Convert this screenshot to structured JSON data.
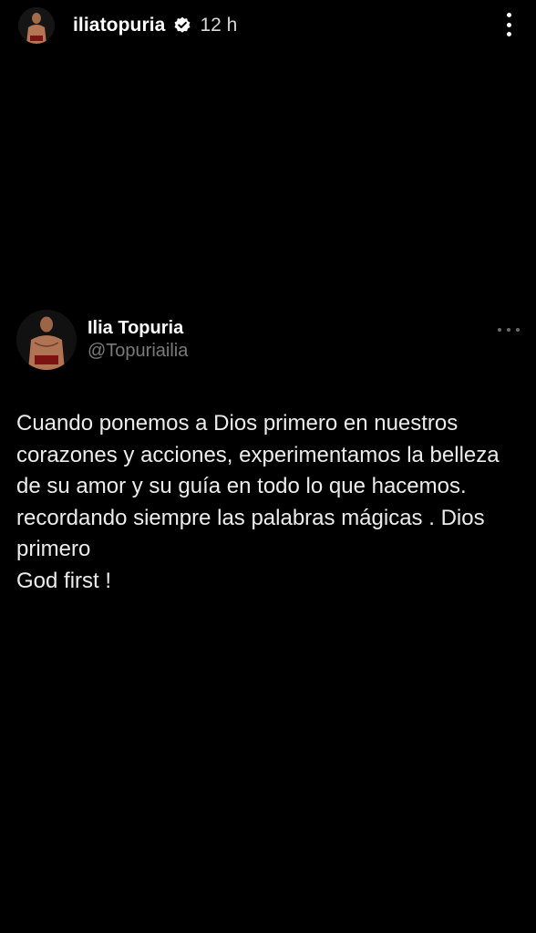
{
  "story": {
    "username": "iliatopuria",
    "time": "12 h",
    "verified_icon": "verified-badge-icon",
    "more_icon": "vertical-ellipsis-icon"
  },
  "tweet": {
    "name": "Ilia Topuria",
    "handle": "@Topuriailia",
    "more_icon": "horizontal-ellipsis-icon",
    "body": "Cuando ponemos a Dios primero en nuestros corazones y acciones, experimentamos la belleza de su amor y su guía en todo lo que hacemos. recordando siempre las palabras mágicas . Dios primero\nGod first !"
  },
  "colors": {
    "background": "#000000",
    "text_primary": "#ffffff",
    "text_secondary": "#7a7a7a"
  }
}
